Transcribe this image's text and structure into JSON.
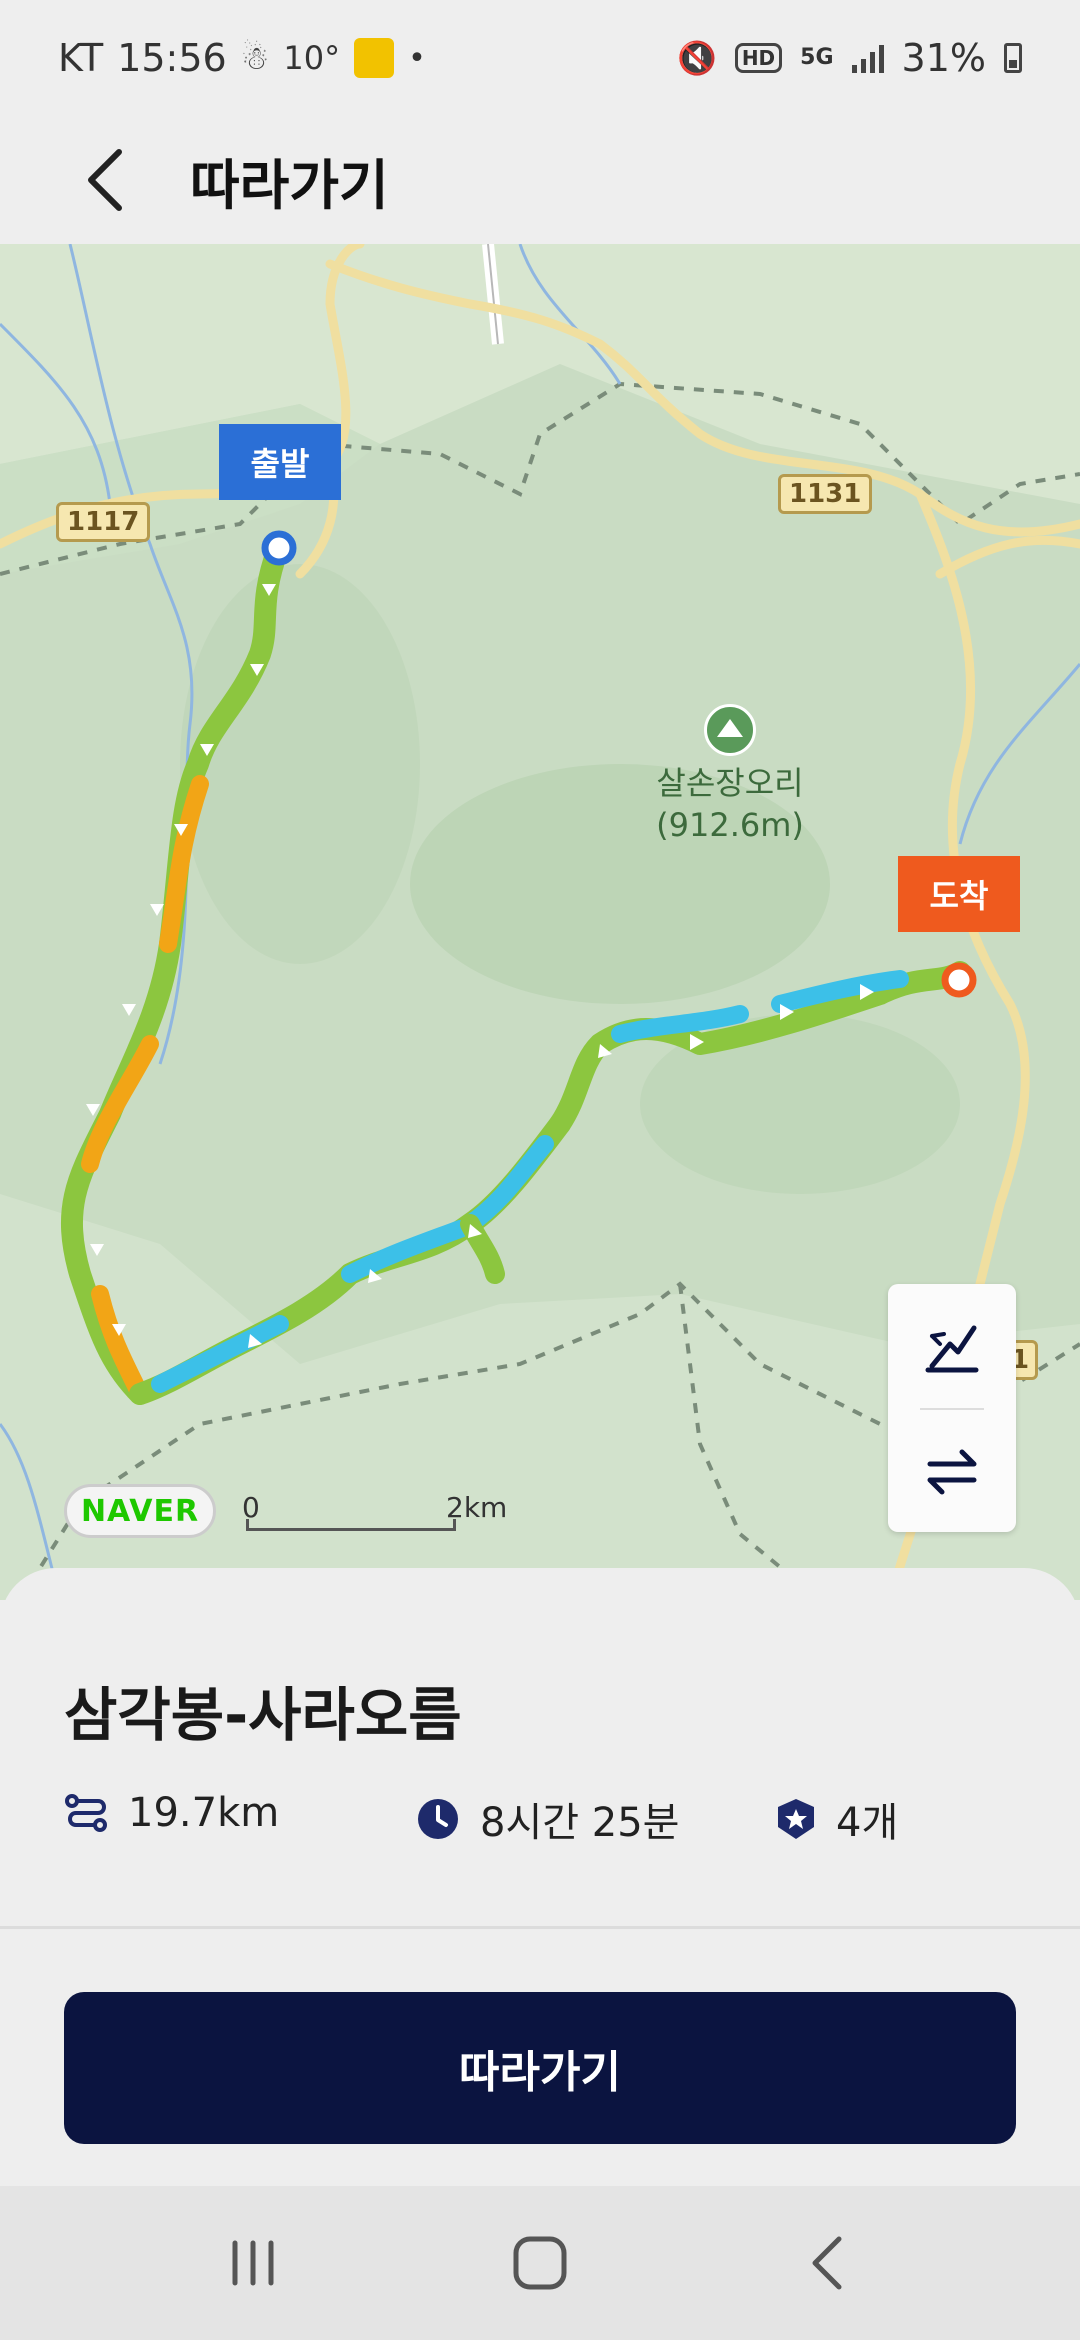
{
  "status_bar": {
    "carrier": "KT",
    "time": "15:56",
    "temperature": "10°",
    "battery": "31%",
    "network": "5G",
    "hd": "HD"
  },
  "header": {
    "title": "따라가기"
  },
  "map": {
    "start_label": "출발",
    "end_label": "도착",
    "peak_name": "살손장오리",
    "peak_elevation": "(912.6m)",
    "road_badges": [
      "1117",
      "1131",
      "1"
    ],
    "scale_start": "0",
    "scale_end": "2km",
    "provider": "NAVER"
  },
  "course": {
    "title": "삼각봉-사라오름",
    "distance": "19.7km",
    "duration": "8시간 25분",
    "stamps": "4개"
  },
  "actions": {
    "follow_label": "따라가기"
  },
  "colors": {
    "accent_dark": "#0b1440",
    "start_marker": "#2b6fd6",
    "end_marker": "#ef5a1e",
    "route_green": "#8cc63f",
    "route_orange": "#f2a516",
    "route_blue": "#3cc0e8"
  }
}
